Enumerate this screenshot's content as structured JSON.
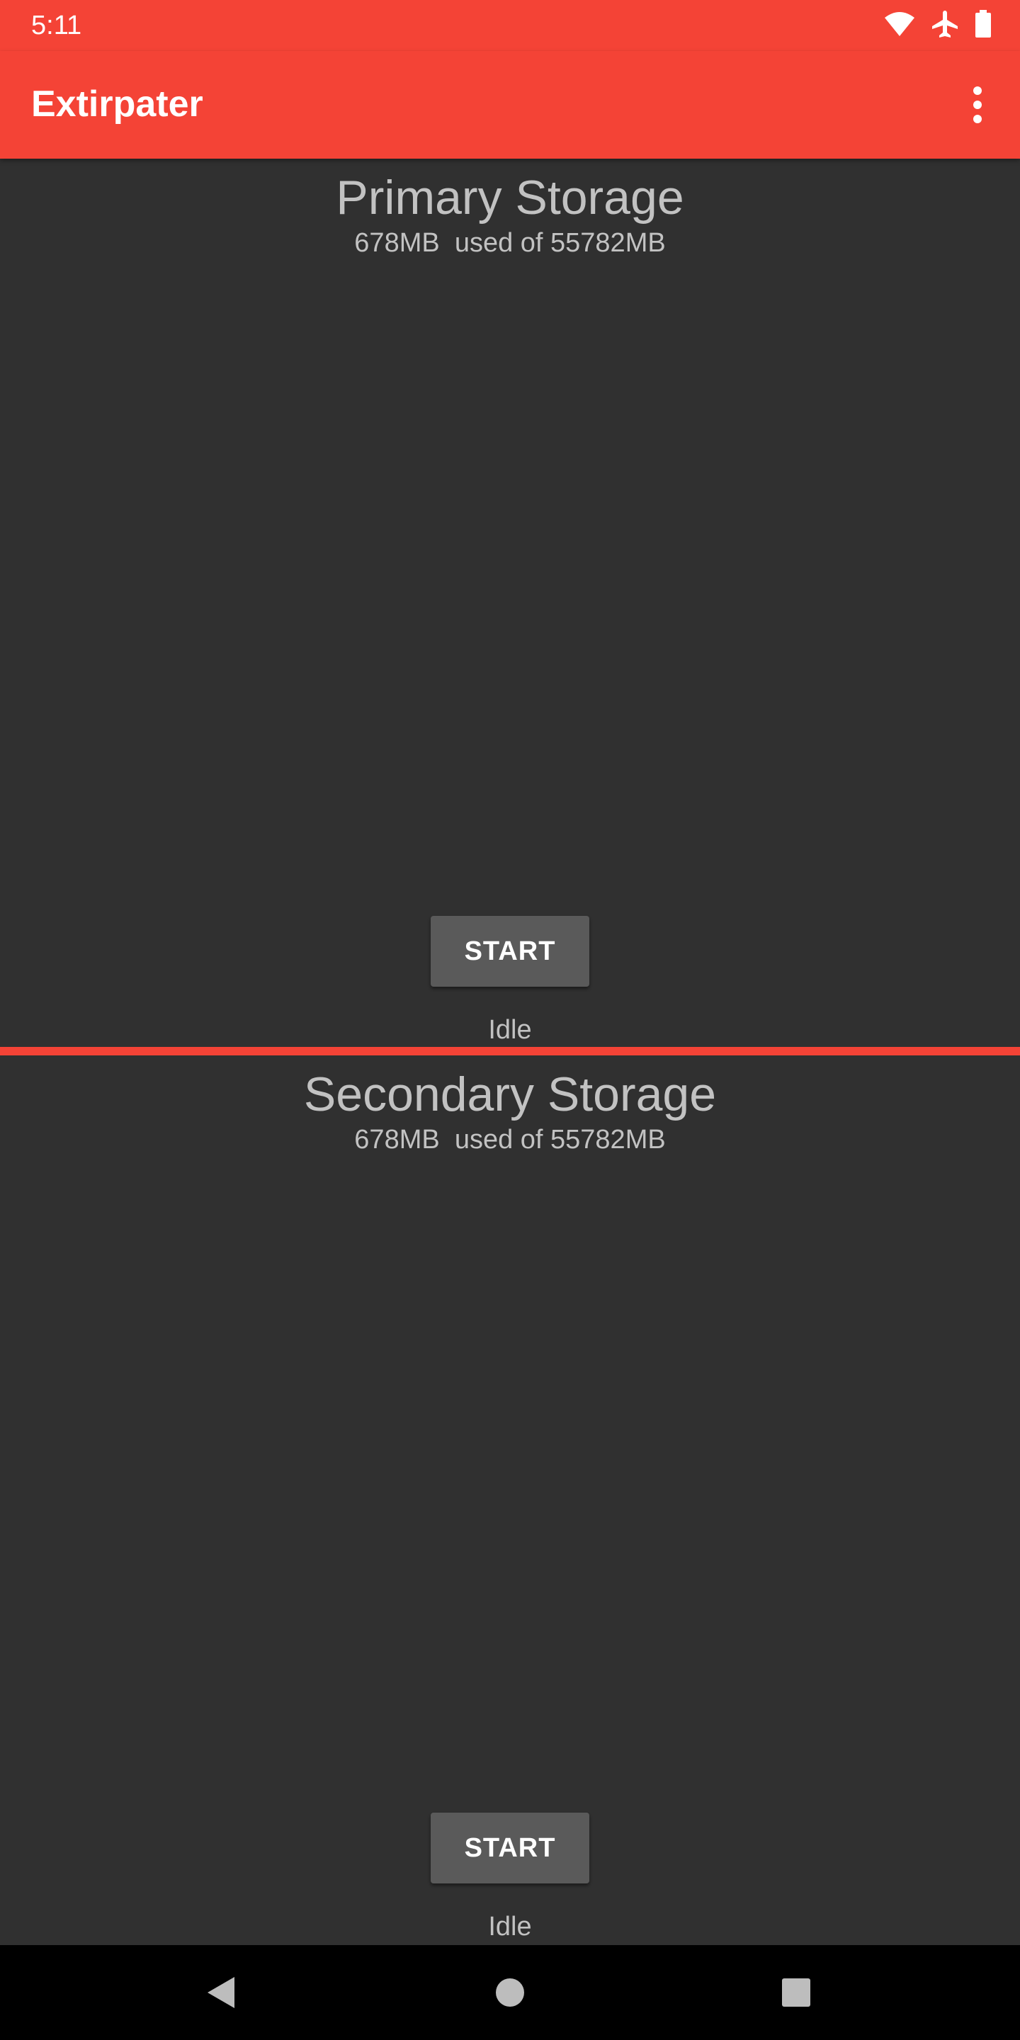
{
  "status_bar": {
    "time": "5:11",
    "icons": [
      "wifi-icon",
      "airplane-mode-icon",
      "battery-icon"
    ]
  },
  "app_bar": {
    "title": "Extirpater",
    "menu_icon": "more-vert-icon"
  },
  "primary": {
    "title": "Primary Storage",
    "usage": "678MB  used of 55782MB",
    "button_label": "START",
    "status": "Idle"
  },
  "secondary": {
    "title": "Secondary Storage",
    "usage": "678MB  used of 55782MB",
    "button_label": "START",
    "status": "Idle"
  },
  "nav_bar": {
    "icons": [
      "back-icon",
      "home-icon",
      "recents-icon"
    ]
  },
  "colors": {
    "accent": "#f44336",
    "background": "#303030",
    "button": "#5a5a5a",
    "text": "#c2c2c2"
  }
}
